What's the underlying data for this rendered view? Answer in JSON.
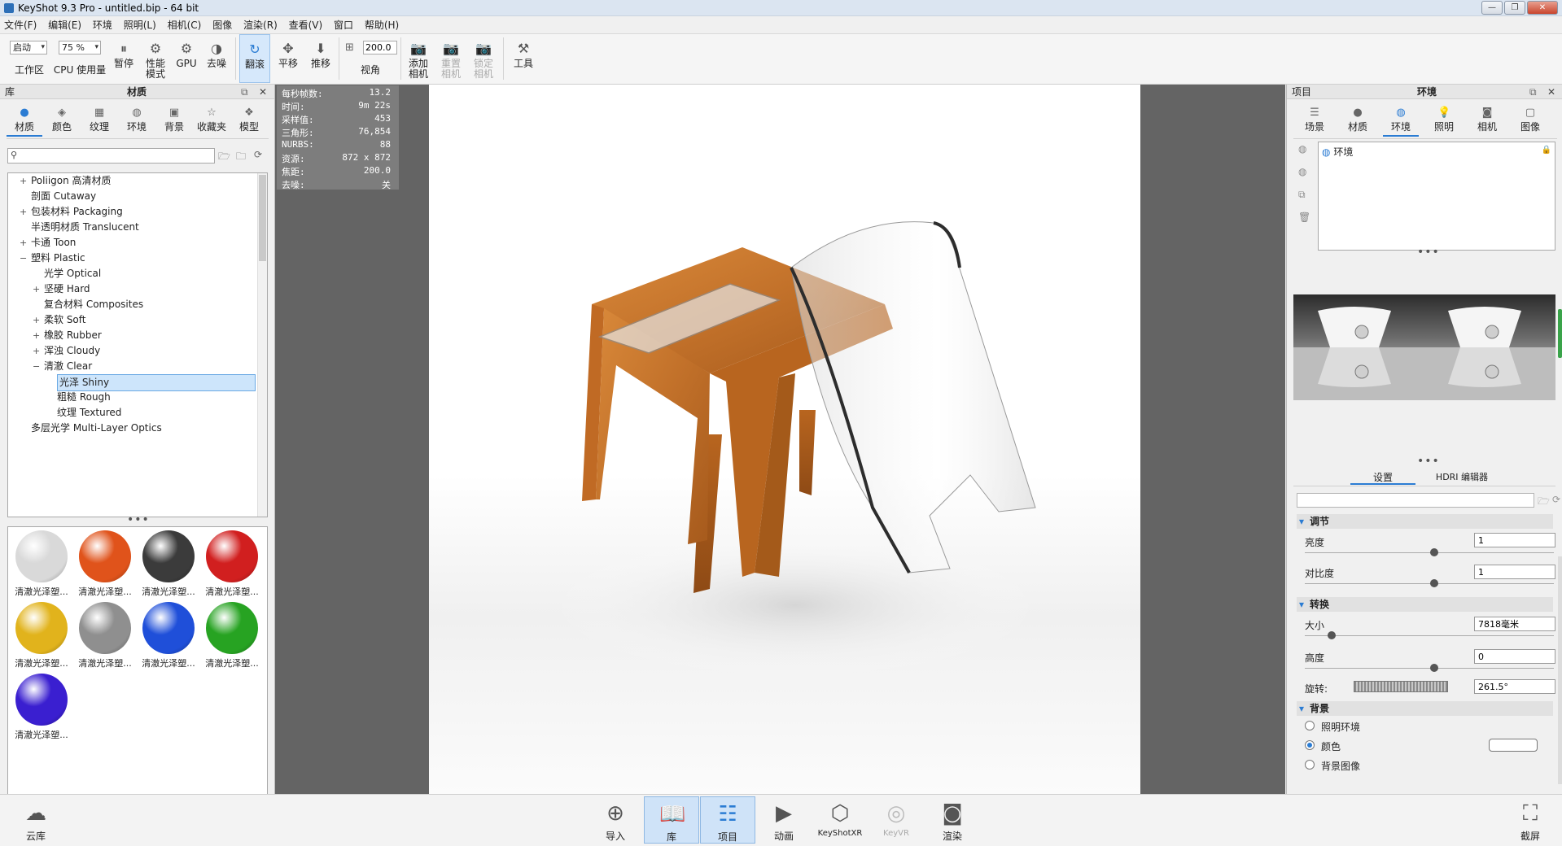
{
  "window": {
    "title": "KeyShot 9.3 Pro  - untitled.bip  - 64 bit"
  },
  "menu": [
    "文件(F)",
    "编辑(E)",
    "环境",
    "照明(L)",
    "相机(C)",
    "图像",
    "渲染(R)",
    "查看(V)",
    "窗口",
    "帮助(H)"
  ],
  "toolbar": {
    "workspace_value": "启动",
    "workspace_label": "工作区",
    "cpu_value": "75 %",
    "cpu_label": "CPU 使用量",
    "pause_label": "暂停",
    "perf_label": "性能\n模式",
    "gpu_label": "GPU",
    "denoise_label": "去噪",
    "tumble_label": "翻滚",
    "pan_label": "平移",
    "dolly_label": "推移",
    "fov_value": "200.0",
    "fov_label": "视角",
    "add_camera_label": "添加\n相机",
    "reset_camera_label": "重置\n相机",
    "lock_camera_label": "锁定\n相机",
    "tools_label": "工具"
  },
  "library": {
    "header_left": "库",
    "header_title": "材质",
    "tabs": [
      "材质",
      "颜色",
      "纹理",
      "环境",
      "背景",
      "收藏夹",
      "模型"
    ],
    "search_placeholder": "",
    "tree": [
      {
        "label": "Poliigon 高清材质",
        "expander": "+",
        "level": 0
      },
      {
        "label": "剖面 Cutaway",
        "expander": "",
        "level": 0
      },
      {
        "label": "包装材料 Packaging",
        "expander": "+",
        "level": 0
      },
      {
        "label": "半透明材质 Translucent",
        "expander": "",
        "level": 0
      },
      {
        "label": "卡通 Toon",
        "expander": "+",
        "level": 0
      },
      {
        "label": "塑料 Plastic",
        "expander": "−",
        "level": 0
      },
      {
        "label": "光学 Optical",
        "expander": "",
        "level": 1
      },
      {
        "label": "坚硬 Hard",
        "expander": "+",
        "level": 1
      },
      {
        "label": "复合材料 Composites",
        "expander": "",
        "level": 1
      },
      {
        "label": "柔软 Soft",
        "expander": "+",
        "level": 1
      },
      {
        "label": "橡胶 Rubber",
        "expander": "+",
        "level": 1
      },
      {
        "label": "浑浊 Cloudy",
        "expander": "+",
        "level": 1
      },
      {
        "label": "清澈 Clear",
        "expander": "−",
        "level": 1
      },
      {
        "label": "光泽 Shiny",
        "expander": "",
        "level": 2
      },
      {
        "label": "粗糙 Rough",
        "expander": "",
        "level": 2
      },
      {
        "label": "纹理 Textured",
        "expander": "",
        "level": 2
      },
      {
        "label": "多层光学 Multi-Layer Optics",
        "expander": "",
        "level": 0
      }
    ],
    "selected_index": 13,
    "thumbnails": [
      {
        "label": "清澈光泽塑...",
        "color": "#d9d9d9"
      },
      {
        "label": "清澈光泽塑...",
        "color": "#e0531b"
      },
      {
        "label": "清澈光泽塑...",
        "color": "#3b3b3b"
      },
      {
        "label": "清澈光泽塑...",
        "color": "#d11f1f"
      },
      {
        "label": "清澈光泽塑...",
        "color": "#e1b31c"
      },
      {
        "label": "清澈光泽塑...",
        "color": "#8f8f8f"
      },
      {
        "label": "清澈光泽塑...",
        "color": "#1f4fd9"
      },
      {
        "label": "清澈光泽塑...",
        "color": "#27a322"
      },
      {
        "label": "清澈光泽塑...",
        "color": "#3a1fd0"
      }
    ]
  },
  "stats": [
    {
      "k": "每秒帧数:",
      "v": "13.2"
    },
    {
      "k": "时间:",
      "v": "9m 22s"
    },
    {
      "k": "采样值:",
      "v": "453"
    },
    {
      "k": "三角形:",
      "v": "76,854"
    },
    {
      "k": "NURBS:",
      "v": "88"
    },
    {
      "k": "资源:",
      "v": "872 x 872"
    },
    {
      "k": "焦距:",
      "v": "200.0"
    },
    {
      "k": "去噪:",
      "v": "关"
    }
  ],
  "project": {
    "header_left": "项目",
    "header_title": "环境",
    "tabs": [
      "场景",
      "材质",
      "环境",
      "照明",
      "相机",
      "图像"
    ],
    "env_item": "环境",
    "subtabs": [
      "设置",
      "HDRI 编辑器"
    ],
    "adjust": {
      "title": "调节",
      "brightness_label": "亮度",
      "brightness": "1",
      "contrast_label": "对比度",
      "contrast": "1"
    },
    "transform": {
      "title": "转换",
      "size_label": "大小",
      "size": "7818毫米",
      "height_label": "高度",
      "height": "0",
      "rotation_label": "旋转:",
      "rotation": "261.5°"
    },
    "background": {
      "title": "背景",
      "options": [
        "照明环境",
        "颜色",
        "背景图像"
      ],
      "selected": 1,
      "color": "#ffffff"
    }
  },
  "bottombar": {
    "cloud_label": "云库",
    "buttons": [
      "导入",
      "库",
      "项目",
      "动画",
      "KeyShotXR",
      "KeyVR",
      "渲染"
    ],
    "screenshot_label": "截屏"
  },
  "colors": {
    "accent": "#2b7cd3",
    "viewport_bg": "#646464",
    "wood": "#c8742a"
  }
}
